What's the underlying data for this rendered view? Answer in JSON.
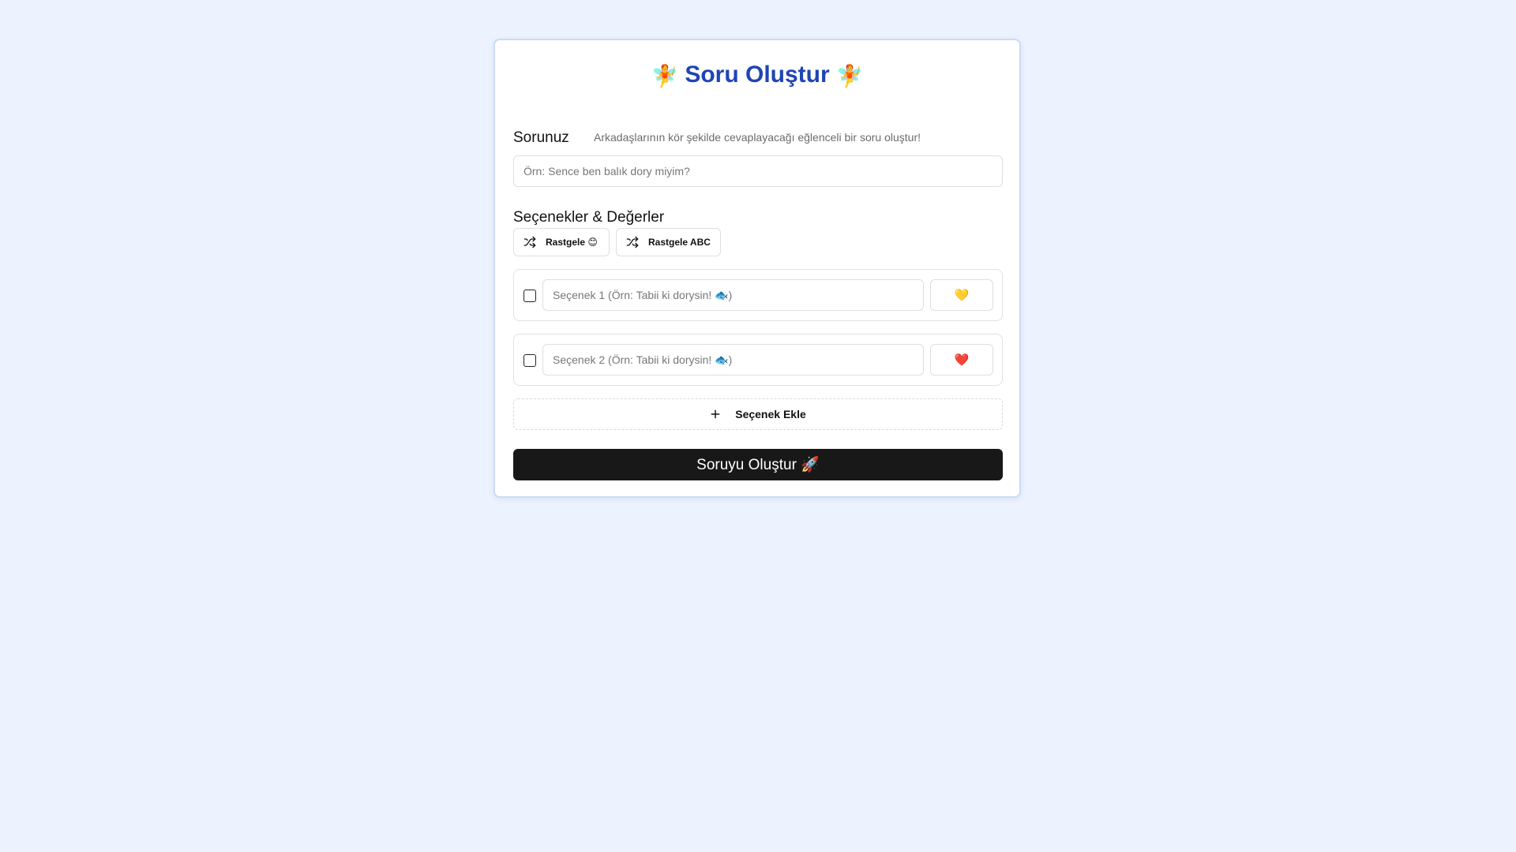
{
  "header": {
    "title": "Soru Oluştur",
    "title_emoji": "🧚",
    "subtitle": "Arkadaşlarının kör şekilde cevaplayacağı eğlenceli bir soru oluştur!"
  },
  "question": {
    "label": "Sorunuz",
    "placeholder": "Örn: Sence ben balık dory miyim?",
    "value": ""
  },
  "options_section": {
    "label": "Seçenekler & Değerler",
    "shuffle_emoji_label": "Rastgele 😊",
    "shuffle_abc_label": "Rastgele ABC",
    "items": [
      {
        "placeholder": "Seçenek 1 (Örn: Tabii ki dorysin! 🐟)",
        "value": "",
        "checked": false,
        "value_emoji": "💛"
      },
      {
        "placeholder": "Seçenek 2 (Örn: Tabii ki dorysin! 🐟)",
        "value": "",
        "checked": false,
        "value_emoji": "❤️"
      }
    ],
    "add_option_label": "Seçenek Ekle"
  },
  "submit": {
    "label": "Soruyu Oluştur 🚀"
  },
  "icons": {
    "shuffle": "shuffle-icon",
    "plus": "plus-icon",
    "checkbox": "checkbox"
  },
  "colors": {
    "background": "#edf3fe",
    "title": "#1f44b5",
    "card_border": "#c9dcf6",
    "primary_button": "#181818"
  }
}
